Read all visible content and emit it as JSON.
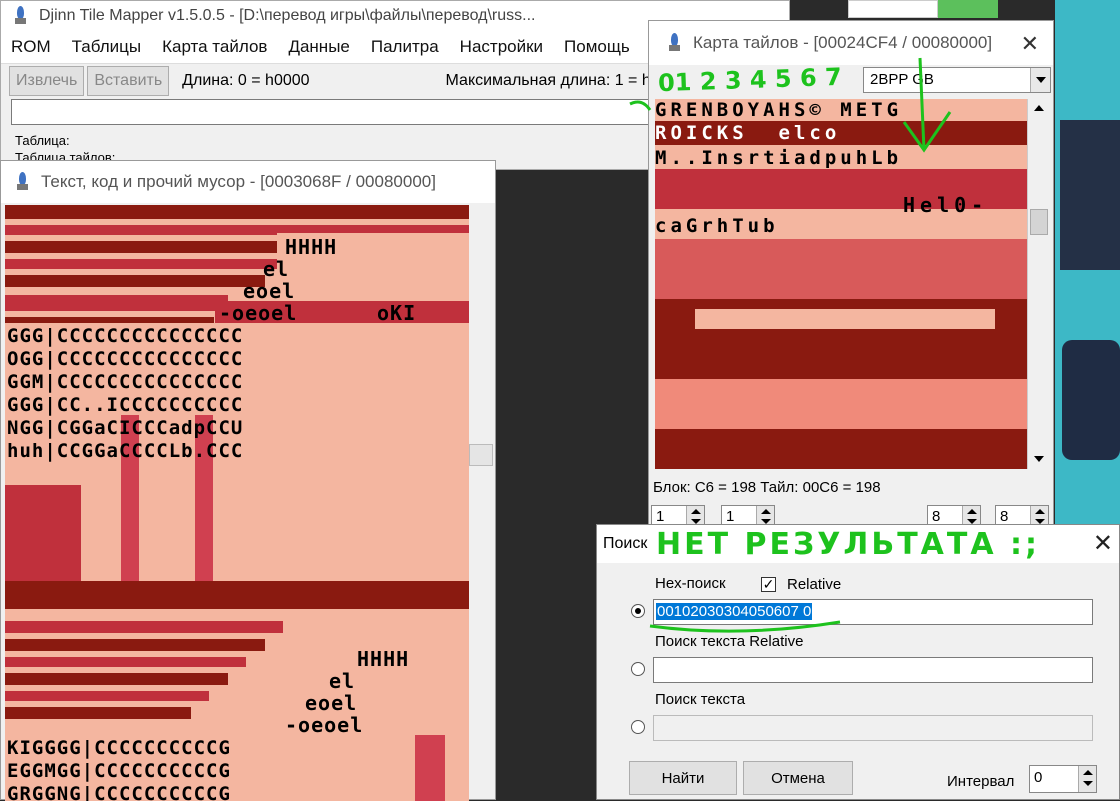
{
  "main_window": {
    "title": "Djinn Tile Mapper v1.5.0.5 - [D:\\перевод игры\\файлы\\перевод\\russ...",
    "menu": [
      "ROM",
      "Таблицы",
      "Карта тайлов",
      "Данные",
      "Палитра",
      "Настройки",
      "Помощь"
    ],
    "toolbar": {
      "extract_label": "Извлечь",
      "insert_label": "Вставить",
      "length_label": "Длина: 0 = h0000",
      "max_length_label": "Максимальная длина: 1 = h"
    },
    "table_label": "Таблица:",
    "tile_table_label": "Таблица тайлов:"
  },
  "text_window": {
    "title": "Текст, код и прочий мусор - [0003068F / 00080000]",
    "glyph_rows": [
      "HHHH",
      "el",
      "eoel",
      "-oeoel",
      "oKI",
      "GGG|CCCCCCCCCCCCCCC",
      "OGG|CCCCCCCCCCCCCCC",
      "GGM|CCCCCCCCCCCCCCC",
      "GGG|CC..ICCCCCCCCCC",
      "NGG|CGGaCICCCadpCCU",
      "huh|CCGGaCCCCLb.CCC",
      "HHHH",
      "el",
      "eoel",
      "-oeoel",
      "KIGGGG|CCCCCCCCCCG",
      "EGGMGG|CCCCCCCCCCG",
      "GRGGNG|CCCCCCCCCCG"
    ]
  },
  "map_window": {
    "title": "Карта тайлов - [00024CF4 / 00080000]",
    "format": "2BPP GB",
    "glyph_rows": [
      "GRENBOYAHS© METG",
      "ROICKS  elco",
      "M..InsrtiadpuhLb",
      "Hel0-",
      "caGrhTub"
    ],
    "status": "Блок: C6 = 198  Тайл: 00C6 = 198",
    "spin_values": [
      "1",
      "1",
      "8",
      "8"
    ]
  },
  "search_dialog": {
    "title": "Поиск",
    "hex_search_label": "Hex-поиск",
    "relative_checkbox_label": "Relative",
    "relative_checked": true,
    "hex_value": "00102030304050607 0",
    "relative_text_label": "Поиск текста Relative",
    "text_search_label": "Поиск текста",
    "find_button": "Найти",
    "cancel_button": "Отмена",
    "interval_label": "Интервал",
    "interval_value": "0"
  },
  "annotations": {
    "digits": "01 2 3 4 5 6 7",
    "no_result": "НЕТ РЕЗУЛЬТАТА :;"
  },
  "colors": {
    "tile_light": "#f4b6a0",
    "tile_dark": "#8a1a10",
    "tile_mid": "#d04050",
    "annotation": "#1dc21d",
    "selection": "#0078d7"
  }
}
